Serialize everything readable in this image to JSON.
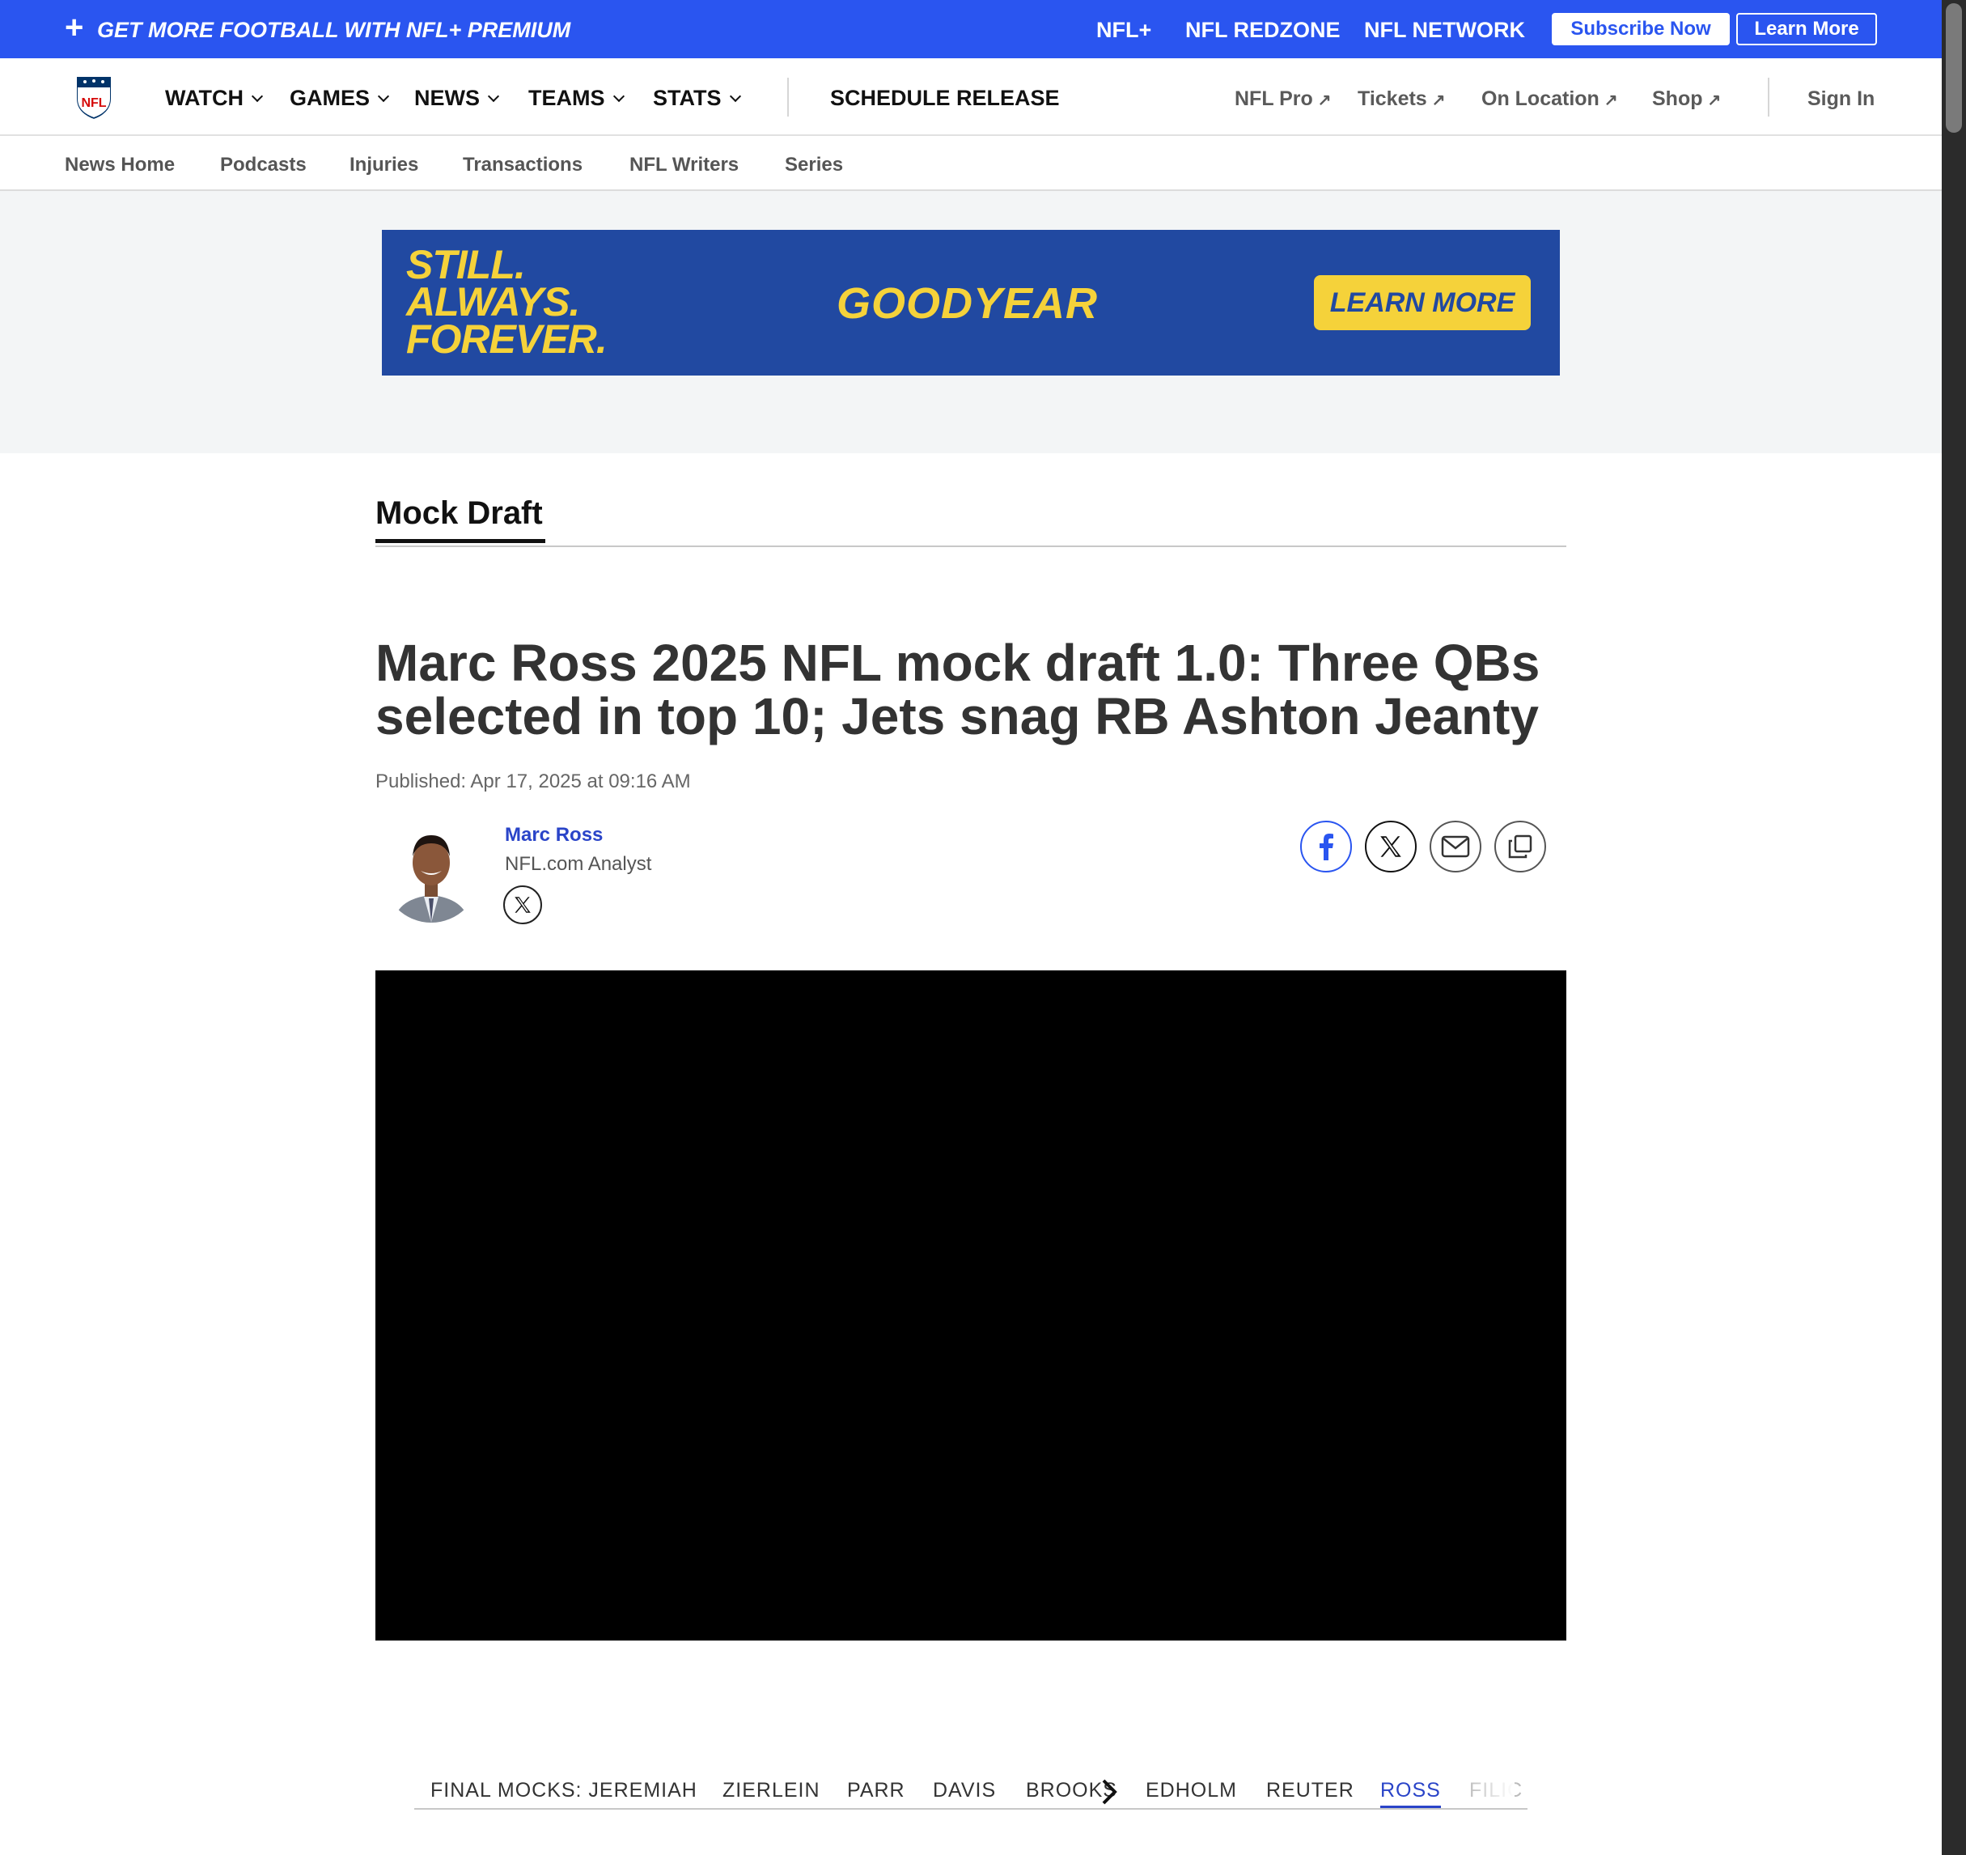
{
  "promo": {
    "tagline": "GET MORE FOOTBALL WITH NFL+ PREMIUM",
    "links": [
      "NFL+",
      "NFL REDZONE",
      "NFL NETWORK"
    ],
    "subscribe_label": "Subscribe Now",
    "learn_more_label": "Learn More"
  },
  "nav": {
    "items": [
      "WATCH",
      "GAMES",
      "NEWS",
      "TEAMS",
      "STATS"
    ],
    "feature": "SCHEDULE RELEASE",
    "external": [
      "NFL Pro",
      "Tickets",
      "On Location",
      "Shop"
    ],
    "sign_in": "Sign In"
  },
  "subnav": {
    "items": [
      "News Home",
      "Podcasts",
      "Injuries",
      "Transactions",
      "NFL Writers",
      "Series"
    ]
  },
  "ad": {
    "slogan": [
      "STILL.",
      "ALWAYS.",
      "FOREVER."
    ],
    "brand": "GOODYEAR",
    "cta": "LEARN MORE"
  },
  "article": {
    "section": "Mock Draft",
    "headline": "Marc Ross 2025 NFL mock draft 1.0: Three QBs selected in top 10; Jets snag RB Ashton Jeanty",
    "published": "Published: Apr 17, 2025 at 09:16 AM",
    "author": {
      "name": "Marc Ross",
      "role": "NFL.com Analyst"
    }
  },
  "mocks": {
    "items": [
      "FINAL MOCKS: JEREMIAH",
      "ZIERLEIN",
      "PARR",
      "DAVIS",
      "BROOKS",
      "EDHOLM",
      "REUTER",
      "ROSS",
      "FILIC"
    ],
    "active_index": 7
  },
  "colors": {
    "promo_blue": "#2a55f0",
    "ad_blue": "#2149a1",
    "ad_yellow": "#f5d23a",
    "link_blue": "#2a44c8"
  }
}
